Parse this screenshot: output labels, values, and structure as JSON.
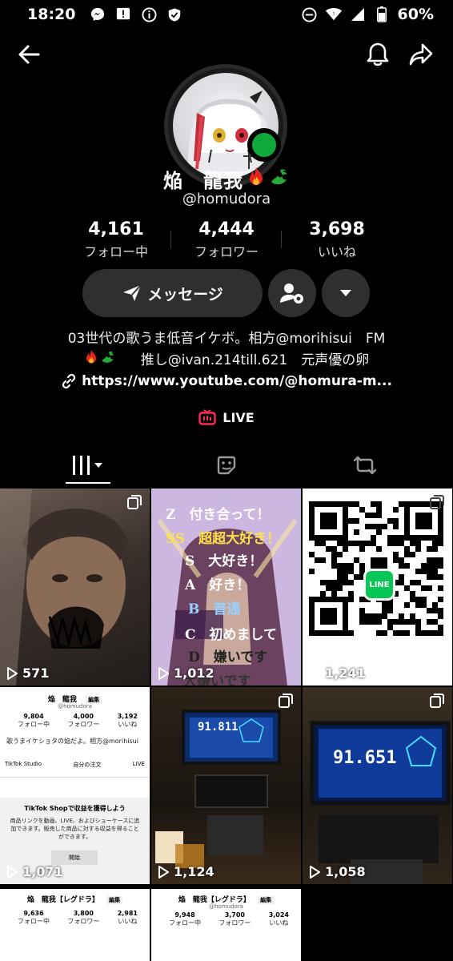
{
  "status_bar": {
    "time": "18:20",
    "battery": "60%",
    "icons": [
      "messenger-icon",
      "alert-icon",
      "info-icon",
      "shield-icon",
      "dnd-icon",
      "wifi-icon",
      "signal-icon",
      "battery-icon"
    ]
  },
  "profile": {
    "name": "焔　龍我",
    "handle": "@homudora",
    "online": true
  },
  "stats": [
    {
      "value": "4,161",
      "label": "フォロー中"
    },
    {
      "value": "4,444",
      "label": "フォロワー"
    },
    {
      "value": "3,698",
      "label": "いいね"
    }
  ],
  "actions": {
    "message_label": "メッセージ"
  },
  "bio": {
    "line1": "03世代の歌うま低音イケボ。相方@morihisui　FM",
    "line2": "　推し@ivan.214till.621　元声優の卵",
    "link": "https://www.youtube.com/@homura-m..."
  },
  "live": {
    "label": "LIVE"
  },
  "tabs": [
    {
      "name": "videos",
      "icon": "grid-icon"
    },
    {
      "name": "favorites",
      "icon": "sticker-icon"
    },
    {
      "name": "reposts",
      "icon": "repost-icon"
    }
  ],
  "videos": [
    {
      "views": "571"
    },
    {
      "views": "1,012",
      "tiers": [
        "Z　付き合って！",
        "SS　超超大好き！",
        "S　大好き！",
        "A　好き！",
        "B　普通",
        "C　初めまして",
        "D　嫌いです",
        "大嫌いです"
      ]
    },
    {
      "views": "1,241",
      "badge": "LINE"
    },
    {
      "views": "1,071",
      "mini_name": "焔　龍我",
      "mini_handle": "@homudora",
      "mini_edit": "編集",
      "mini_stats": [
        {
          "v": "9,804",
          "l": "フォロー中"
        },
        {
          "v": "4,000",
          "l": "フォロワー"
        },
        {
          "v": "3,192",
          "l": "いいね"
        }
      ],
      "mini_bio": "歌うまイケショタの焔だよ。相方@morihisui　FM",
      "mini_tiktok": "TikTok Studio",
      "mini_orders": "自分の注文",
      "mini_live": "LIVE",
      "shop_title": "TikTok Shopで収益を獲得しよう",
      "shop_text": "商品リンクを動画、LIVE、およびショーケースに追加できます。販売した商品に対する収益を得ることができます。",
      "shop_btn": "開始"
    },
    {
      "views": "1,124",
      "score": "91.811"
    },
    {
      "views": "1,058",
      "score": "91.651"
    },
    {
      "mini_name": "焔　龍我【レグドラ】",
      "mini_edit": "編集",
      "mini_stats": [
        {
          "v": "9,636",
          "l": "フォロー中"
        },
        {
          "v": "3,800",
          "l": "フォロワー"
        },
        {
          "v": "2,981",
          "l": "いいね"
        }
      ]
    },
    {
      "mini_name": "焔　龍我【レグドラ】",
      "mini_handle": "@homudora",
      "mini_edit": "編集",
      "mini_stats": [
        {
          "v": "9,948",
          "l": "フォロー中"
        },
        {
          "v": "3,700",
          "l": "フォロワー"
        },
        {
          "v": "3,024",
          "l": "いいね"
        }
      ]
    }
  ],
  "colors": {
    "background": "#000000",
    "button_bg": "#2f2f2f",
    "online_dot": "#0fa83b",
    "live_red": "#fe2c55"
  }
}
